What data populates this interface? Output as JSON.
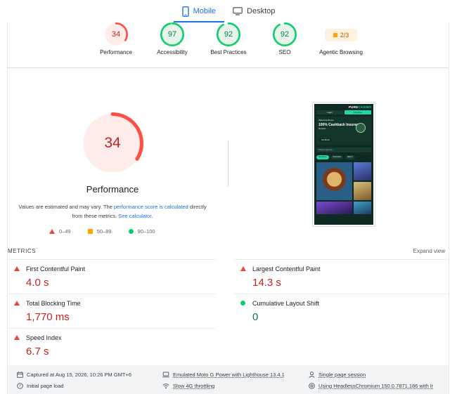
{
  "device_tabs": [
    {
      "label": "Mobile",
      "icon": "smartphone-icon",
      "active": true
    },
    {
      "label": "Desktop",
      "icon": "desktop-icon",
      "active": false
    }
  ],
  "categories": [
    {
      "label": "Performance",
      "score": "34",
      "status": "fail",
      "fraction": 0.34
    },
    {
      "label": "Accessibility",
      "score": "97",
      "status": "pass",
      "fraction": 0.97
    },
    {
      "label": "Best Practices",
      "score": "92",
      "status": "pass",
      "fraction": 0.92
    },
    {
      "label": "SEO",
      "score": "92",
      "status": "pass",
      "fraction": 0.92
    },
    {
      "label": "Agentic Browsing",
      "score": "2/3",
      "status": "average"
    }
  ],
  "performance": {
    "score": "34",
    "fraction": 0.34,
    "title": "Performance",
    "note_1": "Values are estimated and may vary. The ",
    "note_link_1": "performance score is calculated",
    "note_2": " directly from these metrics. ",
    "note_link_2": "See calculator",
    "note_3": "."
  },
  "legend": {
    "fail": "0–49",
    "average": "50–89",
    "pass": "90–100"
  },
  "screenshot": {
    "logo_a": "PURE",
    "logo_b": "CASINO",
    "login": "Login",
    "register": "Register",
    "promo_tag": "Welcome Bonus",
    "promo_title": "100% Cashback Insurance",
    "promo_sub": "Deposit",
    "promo_cta": "Get Bonus",
    "search_placeholder": "Search games...",
    "cat_1": "All Games",
    "cat_2": "Favourites",
    "cat_3": "New P"
  },
  "metrics": {
    "section_label": "METRICS",
    "expand_label": "Expand view",
    "items": [
      {
        "name": "First Contentful Paint",
        "value": "4.0 s",
        "status": "fail"
      },
      {
        "name": "Largest Contentful Paint",
        "value": "14.3 s",
        "status": "fail"
      },
      {
        "name": "Total Blocking Time",
        "value": "1,770 ms",
        "status": "fail"
      },
      {
        "name": "Cumulative Layout Shift",
        "value": "0",
        "status": "pass"
      },
      {
        "name": "Speed Index",
        "value": "6.7 s",
        "status": "fail"
      }
    ]
  },
  "runtime": {
    "captured": "Captured at Aug 15, 2026, 10:26 PM GMT+6",
    "initial_load": "Initial page load",
    "device": "Emulated Moto G Power with Lighthouse 13.4.1",
    "throttling": "Slow 4G throttling",
    "session": "Single page session",
    "browser": "Using HeadlessChromium 150.0.7871.186 with lr"
  },
  "colors": {
    "fail": "#c5221f",
    "fail_ring": "#ff4e42",
    "fail_bg": "#fdecea",
    "pass": "#0d7b45",
    "pass_ring": "#0cce6b",
    "pass_bg": "#e6f4ea",
    "average": "#ffa400",
    "accent": "#1a73e8"
  }
}
